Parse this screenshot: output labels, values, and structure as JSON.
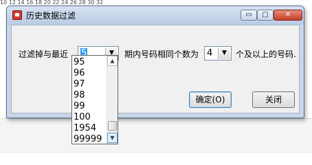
{
  "background": {
    "top_numbers": "10  12  14  16  18  20  22  24  26  28  30  32"
  },
  "dialog": {
    "title": "历史数据过滤",
    "window_buttons": {
      "minimize": "▭",
      "maximize": "▢",
      "close": "✕"
    },
    "label_filter_recent": "过滤掉与最近",
    "recent_value": "5",
    "label_period_same": "期内号码相同个数为",
    "same_count_value": "4",
    "label_above": "个及以上的号码.",
    "ok_button": "确定(O)",
    "close_button": "关闭",
    "combo_arrow": "▼"
  },
  "dropdown": {
    "options": [
      "95",
      "96",
      "97",
      "98",
      "99",
      "100",
      "1954",
      "99999"
    ],
    "scroll_up": "▲",
    "scroll_down": "▼"
  },
  "colors": {
    "selection": "#3399ff",
    "close_button": "#c3412b"
  }
}
